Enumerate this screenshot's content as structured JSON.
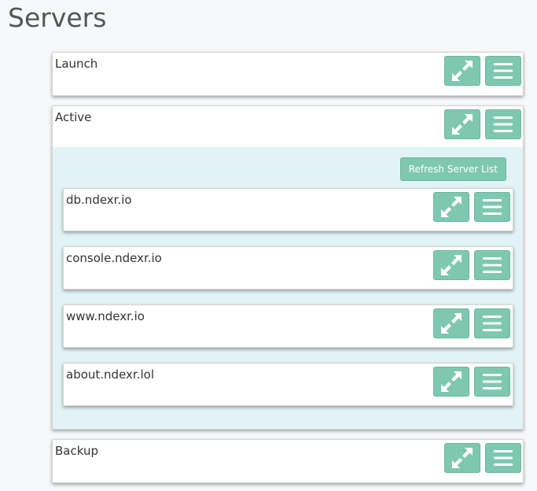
{
  "page": {
    "title": "Servers"
  },
  "groups": {
    "launch": {
      "title": "Launch"
    },
    "active": {
      "title": "Active",
      "refresh_label": "Refresh Server List",
      "servers": [
        {
          "name": "db.ndexr.io"
        },
        {
          "name": "console.ndexr.io"
        },
        {
          "name": "www.ndexr.io"
        },
        {
          "name": "about.ndexr.lol"
        }
      ]
    },
    "backup": {
      "title": "Backup"
    }
  },
  "icons": {
    "expand": "expand-arrows-icon",
    "menu": "hamburger-menu-icon"
  },
  "colors": {
    "button": "#7ec8b0",
    "panel_body": "#e2f3f6",
    "background": "#f7f8fa"
  }
}
